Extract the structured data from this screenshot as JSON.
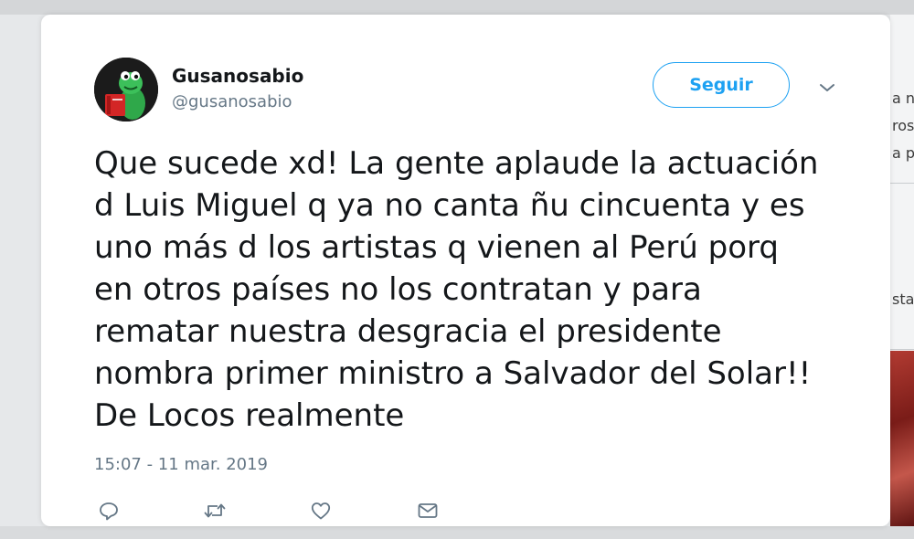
{
  "tweet": {
    "display_name": "Gusanosabio",
    "handle": "@gusanosabio",
    "follow_label": "Seguir",
    "text": "Que sucede xd! La gente aplaude la actuación\nd Luis Miguel q ya no canta ñu cincuenta y es\nuno más d los artistas q vienen al Perú porq\nen otros países no los contratan y para\nrematar nuestra desgracia el presidente\nnombra primer ministro a Salvador del Solar!!\nDe Locos realmente",
    "timestamp": "15:07 - 11 mar. 2019",
    "actions": [
      {
        "icon": "reply-icon"
      },
      {
        "icon": "retweet-icon"
      },
      {
        "icon": "like-icon"
      },
      {
        "icon": "message-icon"
      }
    ]
  },
  "sidebar_fragments": [
    "a n",
    "ros",
    "a p",
    "sta"
  ],
  "colors": {
    "accent": "#1da1f2",
    "text": "#14171a",
    "secondary_text": "#657786",
    "card_bg": "#ffffff"
  }
}
